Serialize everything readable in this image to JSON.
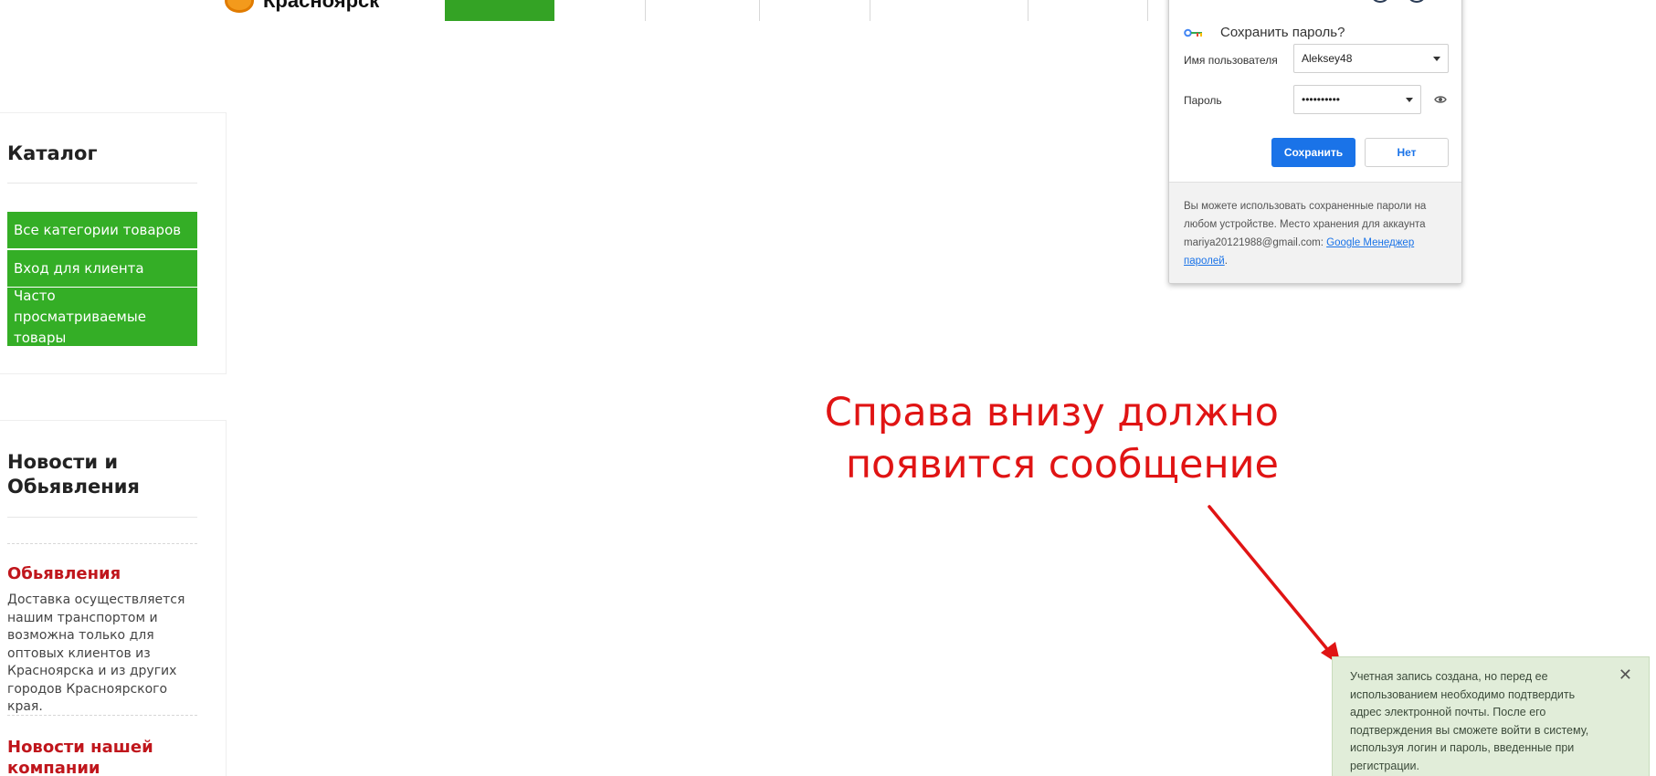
{
  "header": {
    "logo_text": "Красноярск"
  },
  "sidebar": {
    "catalog_title": "Каталог",
    "catalog_items": [
      {
        "label": "Все категории товаров"
      },
      {
        "label": "Вход для клиента"
      },
      {
        "label": "Часто просматриваемые товары"
      }
    ],
    "news_title": "Новости и Обьявления",
    "news": [
      {
        "heading": "Обьявления",
        "text": "Доставка осуществляется нашим транспортом и возможна только для оптовых клиентов из Красноярска и из других городов Красноярского края."
      },
      {
        "heading": "Новости нашей компании"
      }
    ]
  },
  "password_popup": {
    "title": "Сохранить пароль?",
    "username_label": "Имя пользователя",
    "username_value": "Aleksey48",
    "password_label": "Пароль",
    "password_value": "••••••••••",
    "save_label": "Сохранить",
    "no_label": "Нет",
    "footer_text": "Вы можете использовать сохраненные пароли на любом устройстве. Место хранения для аккаунта mariya20121988@gmail.com: ",
    "footer_link": "Google Менеджер паролей",
    "footer_end": "."
  },
  "annotation": {
    "line1": "Справа внизу должно",
    "line2": "появится сообщение"
  },
  "toast": {
    "message": "Учетная запись создана, но перед ее использованием необходимо подтвердить адрес электронной почты. После его подтверждения вы сможете войти в систему, используя логин и пароль, введенные при регистрации.",
    "close_glyph": "✕"
  },
  "colors": {
    "accent_green": "#34ae26",
    "news_red": "#c0161c",
    "annotation_red": "#e01414",
    "chrome_blue": "#1a73e8",
    "toast_bg": "#e1edd9"
  }
}
